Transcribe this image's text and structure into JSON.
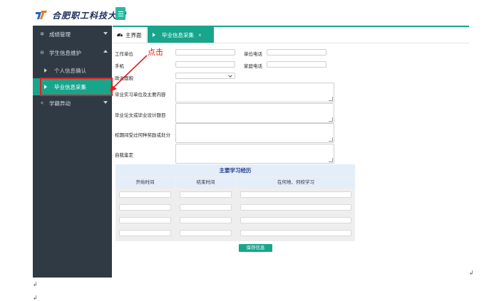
{
  "header": {
    "logo_text": "合肥职工科技大学",
    "logo_icon": "university-logo-icon",
    "menu_icon": "hamburger-icon"
  },
  "sidebar": {
    "items": [
      {
        "label": "成绩管理",
        "icon": "chart-icon",
        "glyph": "✲"
      },
      {
        "label": "学生信息维护",
        "icon": "minus-circle-icon",
        "glyph": "⊖"
      },
      {
        "label": "学籍异动",
        "icon": "share-icon",
        "glyph": "<"
      }
    ],
    "sub_items": [
      {
        "label": "个人信息确认"
      },
      {
        "label": "毕业信息采集"
      }
    ]
  },
  "tabs": {
    "home": {
      "label": "主界面",
      "icon": "dashboard-icon"
    },
    "active": {
      "label": "毕业信息采集",
      "close": "×"
    }
  },
  "annotation": {
    "text": "点击",
    "color": "#e02020"
  },
  "form": {
    "work_unit": "工作单位",
    "unit_phone": "单位电话",
    "mobile": "手机",
    "home_phone": "家庭电话",
    "political_status": "政治面貌",
    "internship": "毕业实习单位及主要内容",
    "thesis": "毕业论文或毕业设计题目",
    "awards": "校期间受过何种奖励或处分",
    "self_eval": "自我鉴定"
  },
  "study_table": {
    "title": "主要学习经历",
    "columns": [
      "开始时间",
      "结束时间",
      "在何地、何校学习"
    ],
    "rows": 4
  },
  "buttons": {
    "save": "保存信息"
  },
  "colors": {
    "accent": "#17a58c",
    "sidebar": "#2f3a45",
    "callout": "#e02020"
  }
}
